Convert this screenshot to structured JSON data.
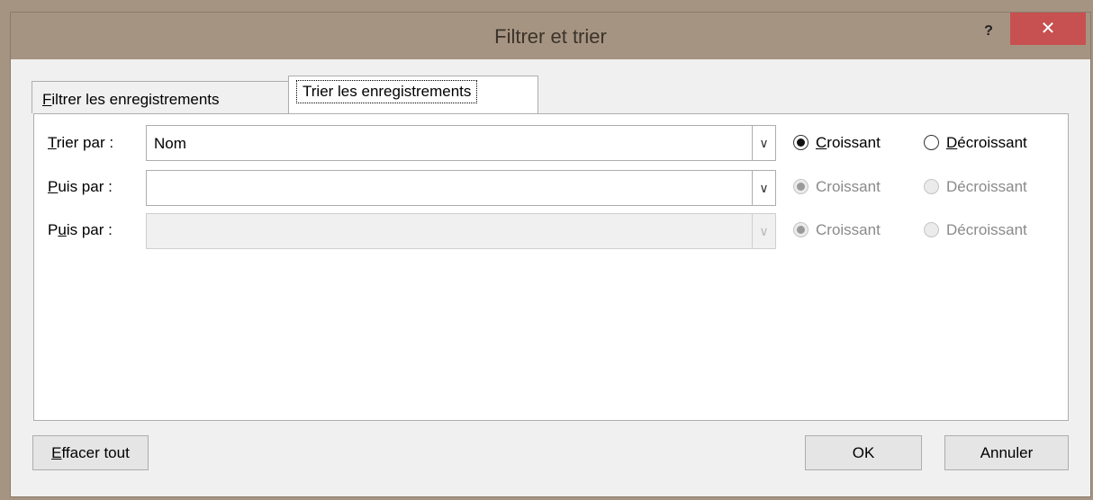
{
  "window": {
    "title": "Filtrer et trier",
    "help": "?",
    "close": "✕"
  },
  "tabs": [
    {
      "label": "Filtrer les enregistrements",
      "underline_char": "F",
      "rest": "iltrer les enregistrements",
      "active": false
    },
    {
      "label": "Trier les enregistrements",
      "prefix": "Trier les enre",
      "underline_char": "g",
      "rest": "istrements",
      "active": true
    }
  ],
  "sort_rows": [
    {
      "label_u": "T",
      "label_rest": "rier par :",
      "value": "",
      "selected": "Nom",
      "enabled": true
    },
    {
      "label_u": "P",
      "label_rest": "uis par :",
      "selected": "",
      "enabled": true
    },
    {
      "label_pre": "P",
      "label_u": "u",
      "label_rest": "is par :",
      "selected": "",
      "enabled": false
    }
  ],
  "order": {
    "ascending": "Croissant",
    "ascending_u": "C",
    "ascending_rest": "roissant",
    "descending": "Décroissant",
    "descending_u": "D",
    "descending_rest": "écroissant"
  },
  "buttons": {
    "clear_u": "E",
    "clear_rest": "ffacer tout",
    "ok": "OK",
    "cancel": "Annuler"
  },
  "icons": {
    "dropdown": "∨"
  }
}
